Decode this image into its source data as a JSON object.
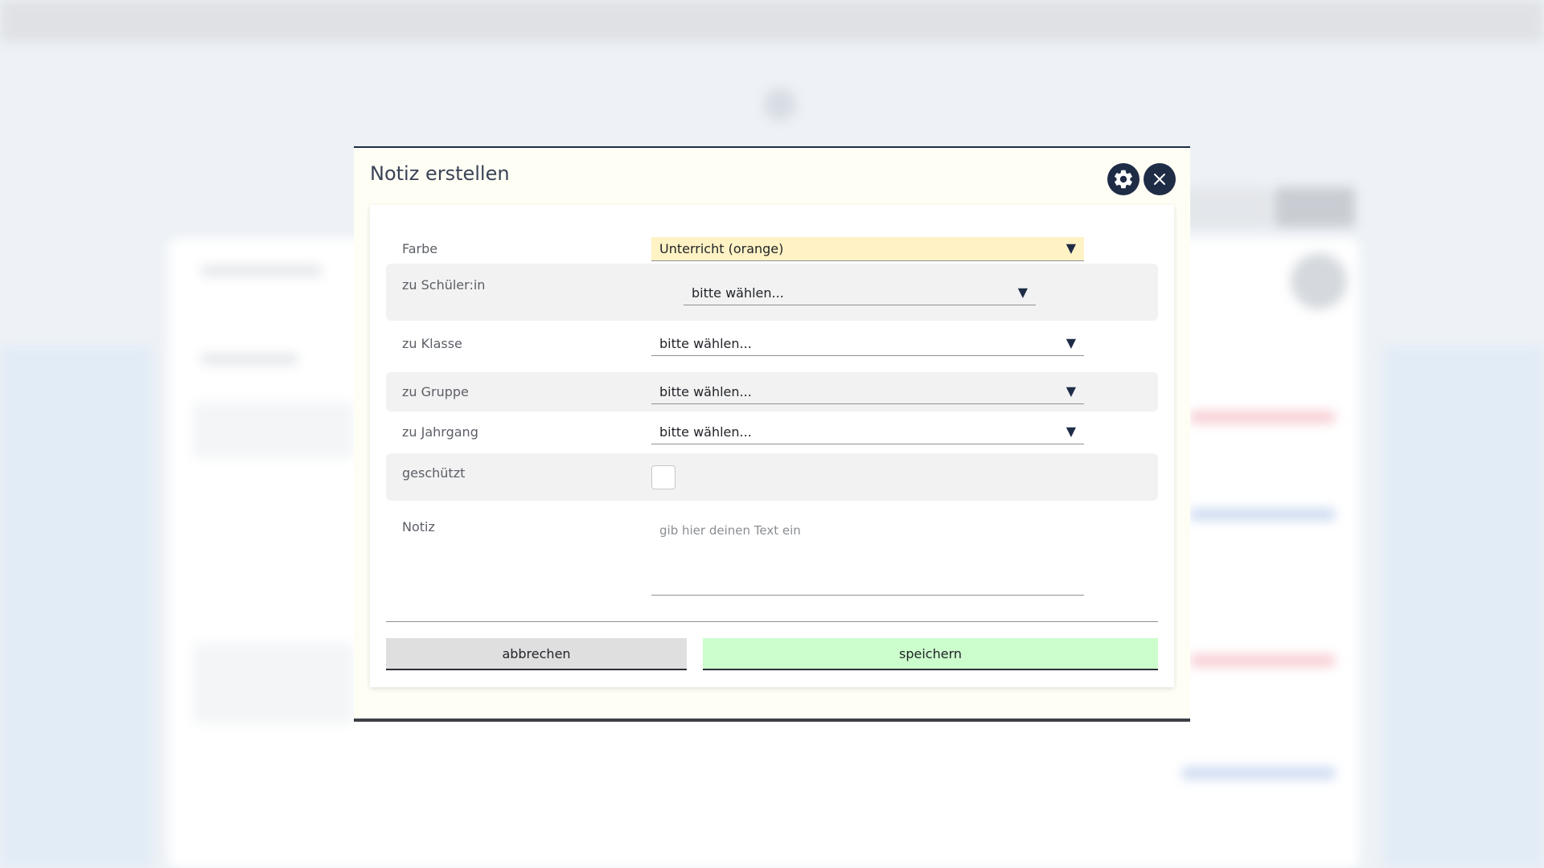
{
  "modal": {
    "title": "Notiz erstellen",
    "settings_icon": "gear-icon",
    "close_icon": "close-icon"
  },
  "form": {
    "farbe": {
      "label": "Farbe",
      "value": "Unterricht (orange)",
      "highlight_color": "#fff2c4"
    },
    "schueler": {
      "label": "zu Schüler:in",
      "value": "bitte wählen..."
    },
    "klasse": {
      "label": "zu Klasse",
      "value": "bitte wählen..."
    },
    "gruppe": {
      "label": "zu Gruppe",
      "value": "bitte wählen..."
    },
    "jahrgang": {
      "label": "zu Jahrgang",
      "value": "bitte wählen..."
    },
    "geschuetzt": {
      "label": "geschützt",
      "checked": false
    },
    "notiz": {
      "label": "Notiz",
      "placeholder": "gib hier deinen Text ein",
      "value": ""
    }
  },
  "actions": {
    "cancel_label": "abbrechen",
    "save_label": "speichern",
    "save_color": "#ccfdcc",
    "cancel_color": "#dfdfdf"
  },
  "colors": {
    "primary_dark": "#1e2c46",
    "modal_background": "#fffef5"
  }
}
